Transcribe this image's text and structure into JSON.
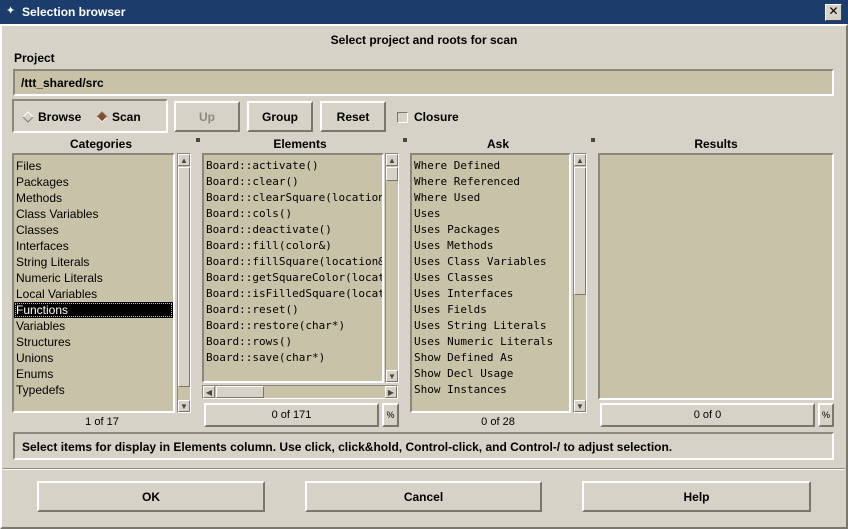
{
  "window": {
    "title": "Selection browser"
  },
  "header": {
    "heading": "Select project and roots for scan"
  },
  "project": {
    "label": "Project",
    "path": "/ttt_shared/src"
  },
  "mode": {
    "browse_label": "Browse",
    "scan_label": "Scan",
    "selected": "Scan"
  },
  "toolbar": {
    "up_label": "Up",
    "group_label": "Group",
    "reset_label": "Reset",
    "closure_label": "Closure"
  },
  "columns": {
    "categories": {
      "header": "Categories",
      "items": [
        "Files",
        "Packages",
        "Methods",
        "Class Variables",
        "Classes",
        "Interfaces",
        "String Literals",
        "Numeric Literals",
        "Local Variables",
        "Functions",
        "Variables",
        "Structures",
        "Unions",
        "Enums",
        "Typedefs"
      ],
      "count": "1 of 17"
    },
    "elements": {
      "header": "Elements",
      "items": [
        "Board::activate()",
        "Board::clear()",
        "Board::clearSquare(location&",
        "Board::cols()",
        "Board::deactivate()",
        "Board::fill(color&)",
        "Board::fillSquare(location&,c",
        "Board::getSquareColor(locati",
        "Board::isFilledSquare(locatio",
        "Board::reset()",
        "Board::restore(char*)",
        "Board::rows()",
        "Board::save(char*)"
      ],
      "count": "0 of 171",
      "filter_label": "%"
    },
    "ask": {
      "header": "Ask",
      "items": [
        "Where Defined",
        "Where Referenced",
        "Where Used",
        "Uses",
        "Uses Packages",
        "Uses Methods",
        "Uses Class Variables",
        "Uses Classes",
        "Uses Interfaces",
        "Uses Fields",
        "Uses String Literals",
        "Uses Numeric Literals",
        "Show Defined As",
        "Show Decl Usage",
        "Show Instances"
      ],
      "count": "0 of 28"
    },
    "results": {
      "header": "Results",
      "items": [],
      "count": "0 of 0",
      "filter_label": "%"
    }
  },
  "status": {
    "message": "Select items for display in Elements column. Use click, click&hold, Control-click, and Control-/ to adjust selection."
  },
  "footer": {
    "ok_label": "OK",
    "cancel_label": "Cancel",
    "help_label": "Help"
  }
}
